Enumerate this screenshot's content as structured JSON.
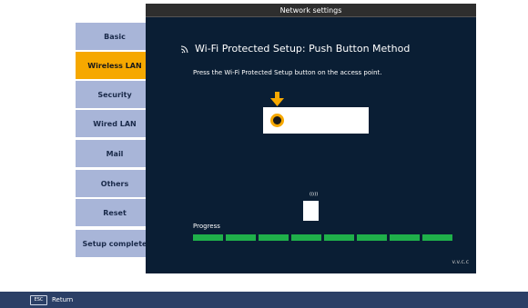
{
  "sidebar": {
    "items": [
      {
        "label": "Basic"
      },
      {
        "label": "Wireless LAN"
      },
      {
        "label": "Security"
      },
      {
        "label": "Wired LAN"
      },
      {
        "label": "Mail"
      },
      {
        "label": "Others"
      },
      {
        "label": "Reset"
      },
      {
        "label": "Setup complete"
      }
    ],
    "active_index": 1
  },
  "panel": {
    "header": "Network settings",
    "title": "Wi-Fi Protected Setup: Push Button Method",
    "instruction": "Press the Wi-Fi Protected Setup button on the access point.",
    "signal_text": "((ı))",
    "progress_label": "Progress",
    "progress_value": 1.0,
    "version": "v.v.c.c"
  },
  "footer": {
    "esc_key": "ESC",
    "return_label": "Return"
  },
  "colors": {
    "active": "#f6a800",
    "sidebar": "#a8b5d8",
    "panel_bg": "#0a1e34",
    "progress": "#1fb04a",
    "footer_bg": "#2b3f66"
  }
}
